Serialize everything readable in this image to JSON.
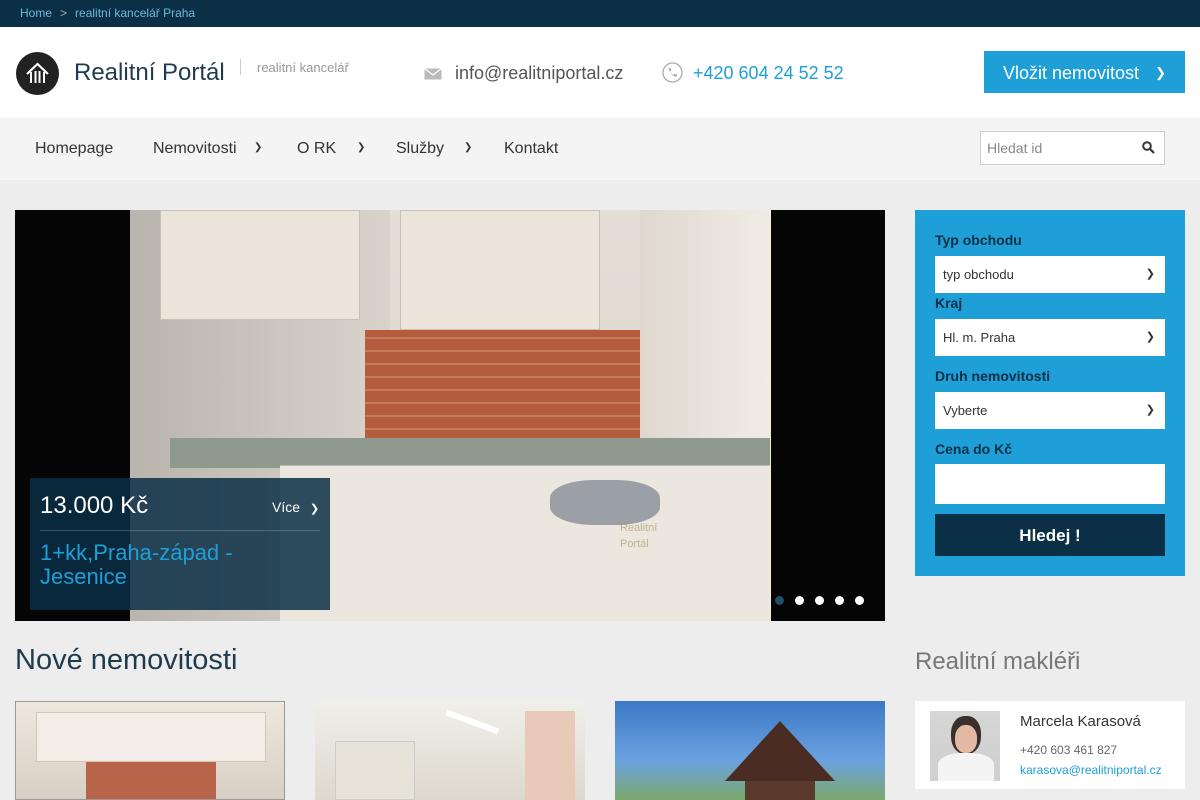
{
  "breadcrumb": {
    "home": "Home",
    "current": "realitní kancelář Praha",
    "separator": ">"
  },
  "header": {
    "brand": "Realitní Portál",
    "tagline": "realitní kancelář",
    "email": "info@realitniportal.cz",
    "phone": "+420 604 24 52 52",
    "add_button": "Vložit nemovitost"
  },
  "nav": {
    "items": [
      "Homepage",
      "Nemovitosti",
      "O RK",
      "Služby",
      "Kontakt"
    ],
    "search_placeholder": "Hledat id"
  },
  "slider": {
    "price": "13.000 Kč",
    "more": "Více",
    "title": "1+kk,Praha-západ - Jesenice",
    "watermark_line1": "Realitní",
    "watermark_line2": "Portál",
    "slide_count": 5,
    "active_slide": 1
  },
  "search_panel": {
    "type_label": "Typ obchodu",
    "type_value": "typ obchodu",
    "region_label": "Kraj",
    "region_value": "Hl. m. Praha",
    "kind_label": "Druh nemovitosti",
    "kind_value": "Vyberte",
    "price_label": "Cena do Kč",
    "price_value": "",
    "submit": "Hledej !"
  },
  "new_listings": {
    "title": "Nové nemovitosti"
  },
  "agents": {
    "title": "Realitní makléři",
    "items": [
      {
        "name": "Marcela Karasová",
        "phone": "+420 603 461 827",
        "email": "karasova@realitniportal.cz"
      }
    ]
  },
  "colors": {
    "accent": "#1e9fd8",
    "dark": "#0b2f45"
  }
}
